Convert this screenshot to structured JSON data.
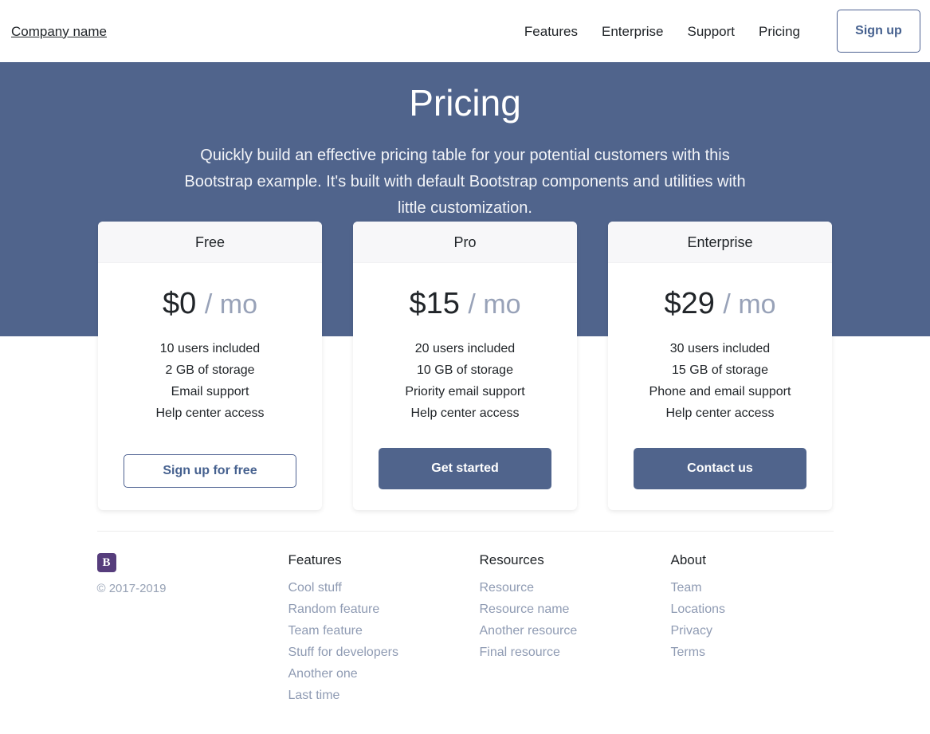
{
  "header": {
    "brand": "Company name",
    "nav_links": [
      {
        "label": "Features"
      },
      {
        "label": "Enterprise"
      },
      {
        "label": "Support"
      },
      {
        "label": "Pricing"
      }
    ],
    "signup_label": "Sign up"
  },
  "hero": {
    "title": "Pricing",
    "lead": "Quickly build an effective pricing table for your potential customers with this Bootstrap example. It's built with default Bootstrap components and utilities with little customization.",
    "background_color": "#50648c"
  },
  "pricing": {
    "cards": [
      {
        "name": "Free",
        "price": "$0",
        "period": "/ mo",
        "features": [
          "10 users included",
          "2 GB of storage",
          "Email support",
          "Help center access"
        ],
        "cta_label": "Sign up for free",
        "cta_style": "outline"
      },
      {
        "name": "Pro",
        "price": "$15",
        "period": "/ mo",
        "features": [
          "20 users included",
          "10 GB of storage",
          "Priority email support",
          "Help center access"
        ],
        "cta_label": "Get started",
        "cta_style": "filled"
      },
      {
        "name": "Enterprise",
        "price": "$29",
        "period": "/ mo",
        "features": [
          "30 users included",
          "15 GB of storage",
          "Phone and email support",
          "Help center access"
        ],
        "cta_label": "Contact us",
        "cta_style": "filled"
      }
    ]
  },
  "footer": {
    "logo_letter": "B",
    "logo_color": "#563d7c",
    "copyright": "© 2017-2019",
    "columns": [
      {
        "title": "Features",
        "links": [
          {
            "label": "Cool stuff"
          },
          {
            "label": "Random feature"
          },
          {
            "label": "Team feature"
          },
          {
            "label": "Stuff for developers"
          },
          {
            "label": "Another one"
          },
          {
            "label": "Last time"
          }
        ]
      },
      {
        "title": "Resources",
        "links": [
          {
            "label": "Resource"
          },
          {
            "label": "Resource name"
          },
          {
            "label": "Another resource"
          },
          {
            "label": "Final resource"
          }
        ]
      },
      {
        "title": "About",
        "links": [
          {
            "label": "Team"
          },
          {
            "label": "Locations"
          },
          {
            "label": "Privacy"
          },
          {
            "label": "Terms"
          }
        ]
      }
    ]
  }
}
